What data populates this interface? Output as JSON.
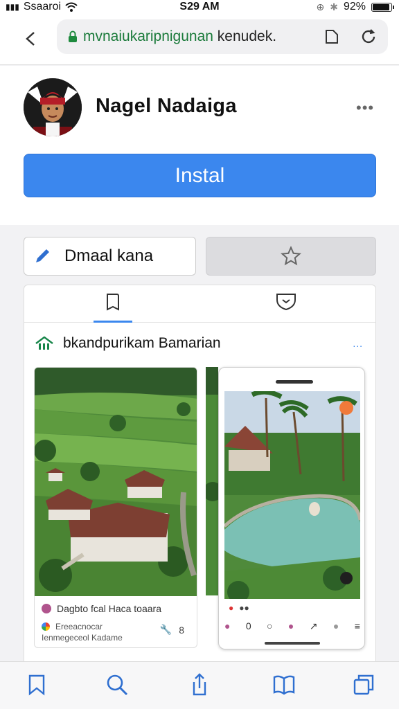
{
  "status": {
    "carrier": "Ssaaroi",
    "time": "S29 AM",
    "battery": "92%"
  },
  "browser": {
    "url_green": "mvnaiukaripnigunan",
    "url_rest": " kenudek."
  },
  "header": {
    "title": "Nagel Nadaiga",
    "more": "•••",
    "install_label": "Instal"
  },
  "actions": {
    "left_label": "Dmaal kana"
  },
  "section": {
    "title": "bkandpurikam Bamarian",
    "more": "..."
  },
  "screenshot1": {
    "caption": "Dagbto fcal Haca toaara",
    "subcaption_line1": "Ereeacnocar",
    "subcaption_line2": "Ienmegeceol Kadame",
    "count": "8"
  },
  "colors": {
    "accent": "#3b87ee",
    "url_domain": "#1a7a3a"
  }
}
